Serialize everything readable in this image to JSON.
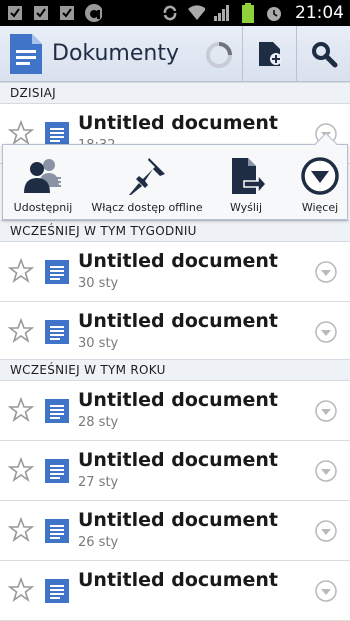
{
  "status_bar": {
    "time": "21:04",
    "icons": [
      "checkbox-icon",
      "checkbox-icon",
      "checkbox-icon",
      "app-a-icon",
      "sync-icon",
      "wifi-icon",
      "signal-icon",
      "battery-icon",
      "alarm-icon"
    ]
  },
  "action_bar": {
    "title": "Dokumenty",
    "icons": [
      "docs-app-icon",
      "loading-spinner-icon",
      "new-document-icon",
      "search-icon"
    ]
  },
  "sections": [
    {
      "label": "DZISIAJ"
    },
    {
      "label": "WCZEŚNIEJ W TYM TYGODNIU"
    },
    {
      "label": "WCZEŚNIEJ W TYM ROKU"
    }
  ],
  "documents": [
    {
      "title": "Untitled document",
      "date": "18:32"
    },
    {
      "title": "Untitled document",
      "date": "30 sty"
    },
    {
      "title": "Untitled document",
      "date": "30 sty"
    },
    {
      "title": "Untitled document",
      "date": "28 sty"
    },
    {
      "title": "Untitled document",
      "date": "27 sty"
    },
    {
      "title": "Untitled document",
      "date": "26 sty"
    },
    {
      "title": "Untitled document",
      "date": ""
    }
  ],
  "popup": {
    "items": [
      {
        "label": "Udostępnij",
        "icon": "share-people-icon"
      },
      {
        "label": "Włącz dostęp offline",
        "icon": "pin-icon"
      },
      {
        "label": "Wyślij",
        "icon": "send-document-icon"
      },
      {
        "label": "Więcej",
        "icon": "more-circle-icon"
      }
    ]
  },
  "colors": {
    "accent": "#1f2d44",
    "doc_blue": "#3f74c9",
    "section_bg": "#eef1f6"
  }
}
